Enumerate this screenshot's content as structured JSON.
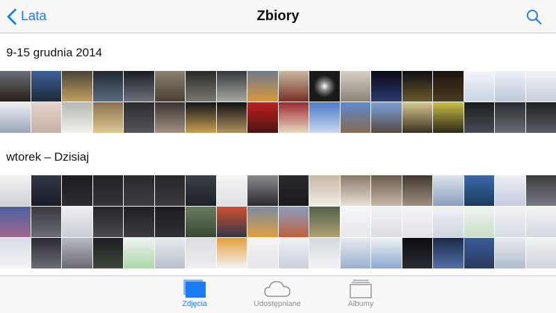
{
  "navbar": {
    "back_label": "Lata",
    "title": "Zbiory"
  },
  "sections": [
    {
      "header": "9-15 grudnia 2014"
    },
    {
      "header": "wtorek – Dzisiaj"
    }
  ],
  "tabbar": {
    "tabs": [
      {
        "label": "Zdjęcia",
        "icon": "photos-icon",
        "active": true
      },
      {
        "label": "Udostępniane",
        "icon": "cloud-icon",
        "active": false
      },
      {
        "label": "Albumy",
        "icon": "albums-icon",
        "active": false
      }
    ]
  },
  "colors": {
    "accent": "#1a7cf5",
    "bar_bg": "#f7f7f8",
    "inactive": "#8e8e93"
  }
}
